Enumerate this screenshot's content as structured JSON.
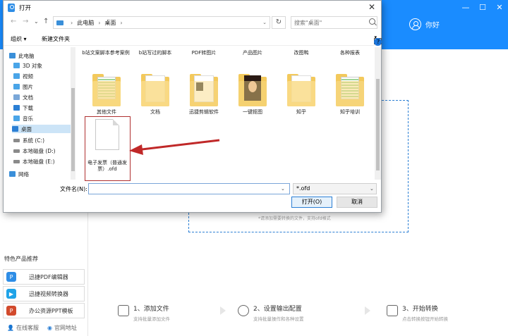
{
  "app": {
    "user_label": "你好",
    "window_controls": [
      "—",
      "☐",
      "✕"
    ],
    "recommend_title": "特色产品推荐",
    "recommend_items": [
      {
        "label": "迅捷PDF编辑器",
        "color": "#2e8de6"
      },
      {
        "label": "迅捷视频转换器",
        "color": "#1fa3e8"
      },
      {
        "label": "办公资源PPT模板",
        "color": "#d24a2c"
      }
    ],
    "bottom_links": [
      "在线客服",
      "官网地址"
    ],
    "drop_hint": "*请添加需要转换的文件，支持ofd格式",
    "steps": [
      {
        "title": "1、添加文件",
        "sub": "支持批量添加文件"
      },
      {
        "title": "2、设置输出配置",
        "sub": "支持批量操作和各种设置"
      },
      {
        "title": "3、开始转换",
        "sub": "点击转换按钮开始转换"
      }
    ],
    "colors": {
      "brand": "#1a8cff",
      "highlight": "#b03030"
    }
  },
  "dialog": {
    "title": "打开",
    "close_label": "✕",
    "nav": {
      "back": "←",
      "forward": "→",
      "dropdown": "⌄",
      "up": "↑"
    },
    "address": [
      "此电脑",
      "桌面"
    ],
    "refresh_label": "↻",
    "search_placeholder": "搜索\"桌面\"",
    "toolbar": {
      "organize": "组织 ▾",
      "new_folder": "新建文件夹",
      "help": "?"
    },
    "nav_items": [
      {
        "label": "此电脑",
        "icon": "computer-icon",
        "color": "#3a8fd9",
        "selected": false
      },
      {
        "label": "3D 对象",
        "icon": "cube-icon",
        "color": "#4aa5e8",
        "selected": false
      },
      {
        "label": "视频",
        "icon": "video-icon",
        "color": "#4aa5e8",
        "selected": false
      },
      {
        "label": "图片",
        "icon": "image-icon",
        "color": "#4aa5e8",
        "selected": false
      },
      {
        "label": "文档",
        "icon": "document-icon",
        "color": "#7aa7d8",
        "selected": false
      },
      {
        "label": "下载",
        "icon": "download-icon",
        "color": "#2b7fd4",
        "selected": false
      },
      {
        "label": "音乐",
        "icon": "music-icon",
        "color": "#4aa5e8",
        "selected": false
      },
      {
        "label": "桌面",
        "icon": "desktop-icon",
        "color": "#2b7fd4",
        "selected": true
      },
      {
        "label": "系统 (C:)",
        "icon": "drive-icon",
        "color": "#8a8a8a",
        "selected": false
      },
      {
        "label": "本地磁盘 (D:)",
        "icon": "drive-icon",
        "color": "#8a8a8a",
        "selected": false
      },
      {
        "label": "本地磁盘 (E:)",
        "icon": "drive-icon",
        "color": "#8a8a8a",
        "selected": false
      },
      {
        "label": "网络",
        "icon": "network-icon",
        "color": "#3a8fd9",
        "selected": false
      }
    ],
    "top_row_labels": [
      "b站文案脚本参考案例",
      "b站写过的脚本",
      "PDF转图片",
      "产品图片",
      "改图鸭",
      "各种报表"
    ],
    "folders": [
      {
        "label": "其他文件",
        "thumb": "green"
      },
      {
        "label": "文档",
        "thumb": "paper"
      },
      {
        "label": "迅捷剪辑软件",
        "thumb": "dark"
      },
      {
        "label": "一键抠图",
        "thumb": "face"
      },
      {
        "label": "知乎",
        "thumb": "paper"
      },
      {
        "label": "知乎培训",
        "thumb": "green"
      }
    ],
    "selected_file": "电子发票（普通发票）.ofd",
    "filename_label": "文件名(N):",
    "filename_value": "",
    "filter_value": "*.ofd",
    "open_button": "打开(O)",
    "cancel_button": "取消"
  }
}
